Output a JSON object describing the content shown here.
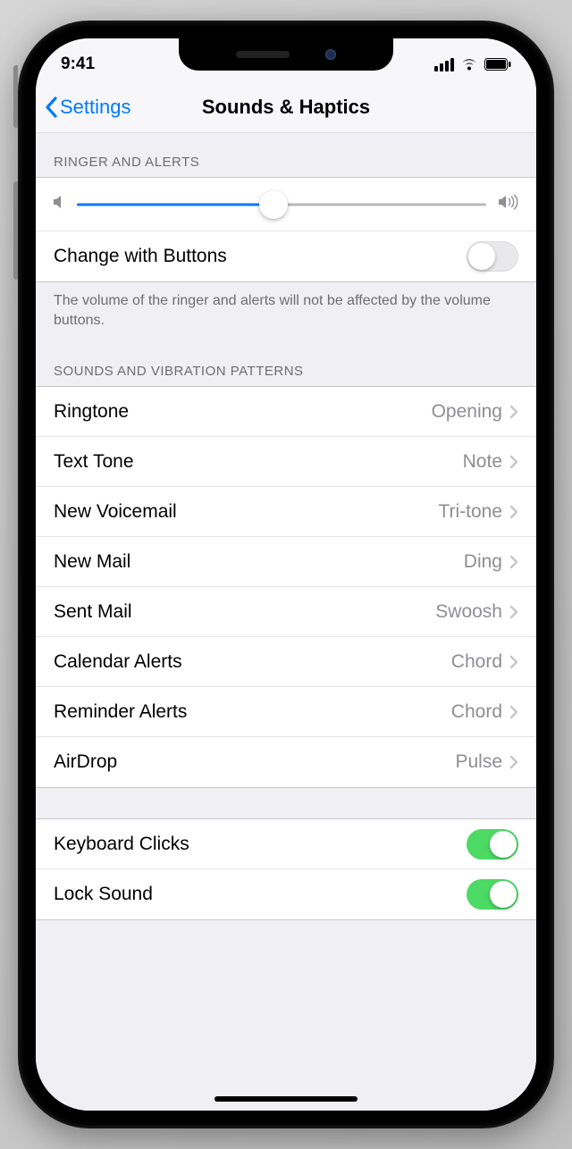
{
  "status": {
    "time": "9:41"
  },
  "nav": {
    "back": "Settings",
    "title": "Sounds & Haptics"
  },
  "ringer": {
    "header": "RINGER AND ALERTS",
    "changeWithButtonsLabel": "Change with Buttons",
    "changeWithButtonsOn": false,
    "volumePercent": 48,
    "footer": "The volume of the ringer and alerts will not be affected by the volume buttons."
  },
  "patterns": {
    "header": "SOUNDS AND VIBRATION PATTERNS",
    "items": [
      {
        "label": "Ringtone",
        "value": "Opening"
      },
      {
        "label": "Text Tone",
        "value": "Note"
      },
      {
        "label": "New Voicemail",
        "value": "Tri-tone"
      },
      {
        "label": "New Mail",
        "value": "Ding"
      },
      {
        "label": "Sent Mail",
        "value": "Swoosh"
      },
      {
        "label": "Calendar Alerts",
        "value": "Chord"
      },
      {
        "label": "Reminder Alerts",
        "value": "Chord"
      },
      {
        "label": "AirDrop",
        "value": "Pulse"
      }
    ]
  },
  "toggles": {
    "keyboardClicksLabel": "Keyboard Clicks",
    "keyboardClicksOn": true,
    "lockSoundLabel": "Lock Sound",
    "lockSoundOn": true
  }
}
